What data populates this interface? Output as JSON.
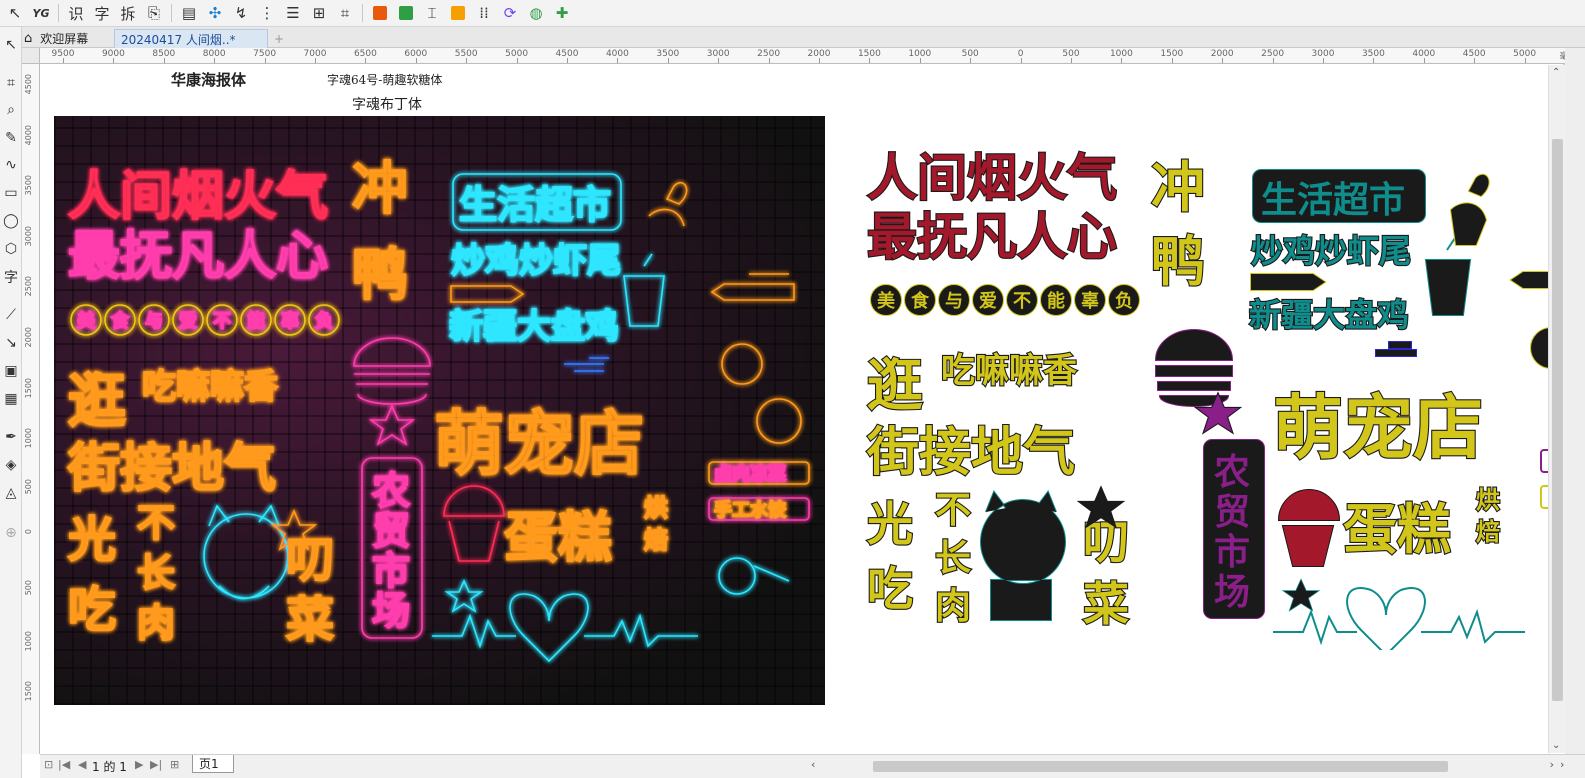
{
  "toolbar": {
    "items": [
      {
        "name": "pick-tool-icon",
        "glyph": "↖"
      },
      {
        "name": "yg-plugin-icon",
        "glyph": "YG"
      },
      {
        "name": "sep"
      },
      {
        "name": "recognize-button",
        "glyph": "识"
      },
      {
        "name": "text-button",
        "glyph": "字"
      },
      {
        "name": "split-button",
        "glyph": "拆"
      },
      {
        "name": "copy-icon",
        "glyph": "⎘"
      },
      {
        "name": "sep"
      },
      {
        "name": "table-icon",
        "glyph": "▤"
      },
      {
        "name": "pattern-icon",
        "glyph": "✣",
        "color": "#1c7ed6"
      },
      {
        "name": "curve-tool-icon",
        "glyph": "↯"
      },
      {
        "name": "align-icon",
        "glyph": "⋮"
      },
      {
        "name": "lines-icon",
        "glyph": "☰"
      },
      {
        "name": "group-icon",
        "glyph": "⊞"
      },
      {
        "name": "select-area-icon",
        "glyph": "⌗"
      },
      {
        "name": "sep"
      },
      {
        "name": "color-palette-icon",
        "color": "#e8590c"
      },
      {
        "name": "image-icon",
        "color": "#2f9e44"
      },
      {
        "name": "text-frame-icon",
        "glyph": "⌶"
      },
      {
        "name": "list-icon",
        "color": "#f59f00"
      },
      {
        "name": "grid-dots-icon",
        "glyph": "⁞⁞"
      },
      {
        "name": "blend-icon",
        "glyph": "⟳",
        "color": "#7048e8"
      },
      {
        "name": "globe-icon",
        "glyph": "◍",
        "color": "#2f9e44"
      },
      {
        "name": "puzzle-icon",
        "glyph": "✚",
        "color": "#2f9e44"
      }
    ]
  },
  "tabs": {
    "welcome": "欢迎屏幕",
    "document": "20240417 人间烟..*",
    "add": "+"
  },
  "ruler": {
    "h_labels": [
      "9500",
      "9000",
      "8500",
      "8000",
      "7500",
      "7000",
      "6500",
      "6000",
      "5500",
      "5000",
      "4500",
      "4000",
      "3500",
      "3000",
      "2500",
      "2000",
      "1500",
      "1000",
      "500",
      "0",
      "500",
      "1000",
      "1500",
      "2000",
      "2500",
      "3000",
      "3500",
      "4000",
      "4500",
      "5000"
    ],
    "h_unit": "毫米",
    "v_labels": [
      "4500",
      "4000",
      "3500",
      "3000",
      "2500",
      "2000",
      "1500",
      "1000",
      "500",
      "0",
      "500",
      "1000",
      "1500"
    ]
  },
  "labels": {
    "font_a": "华康海报体",
    "font_b": "字魂64号-萌趣软糖体",
    "font_c": "字魂布丁体"
  },
  "neon": {
    "line1": "人间烟火气",
    "line2": "最抚凡人心",
    "circles": [
      "美",
      "食",
      "与",
      "爱",
      "不",
      "能",
      "辜",
      "负"
    ],
    "chong": "冲",
    "ya": "鸭",
    "shenghuo": "生活超市",
    "chaoji": "炒鸡炒虾尾",
    "xinjiang": "新疆大盘鸡",
    "guang": "逛",
    "chimala": "吃嘛嘛香",
    "jiejie": "街接地气",
    "guang2": "光",
    "chi": "吃",
    "buzhang": "不",
    "zhang": "长",
    "rou": "肉",
    "dao": "叨",
    "cai": "菜",
    "mengchong": "萌宠店",
    "nongmao": "农贸市场",
    "dangao": "蛋糕",
    "hongbei": "烘焙",
    "luourou": "卤肉凉菜",
    "shougong": "手工水饺"
  },
  "bottom": {
    "page_info": "1 的 1",
    "page_tab": "页1"
  },
  "colors": {
    "red": "#ff2d55",
    "pink": "#ff3cac",
    "orange": "#ff9a1f",
    "yellow": "#f5c518",
    "cyan": "#2ee6ff",
    "blue": "#3a7bff",
    "v_red": "#a3182a",
    "v_yellow": "#d2c61a",
    "v_teal": "#0f8d8d",
    "v_purple": "#8a1f8a",
    "v_dark": "#1a1a1a"
  }
}
